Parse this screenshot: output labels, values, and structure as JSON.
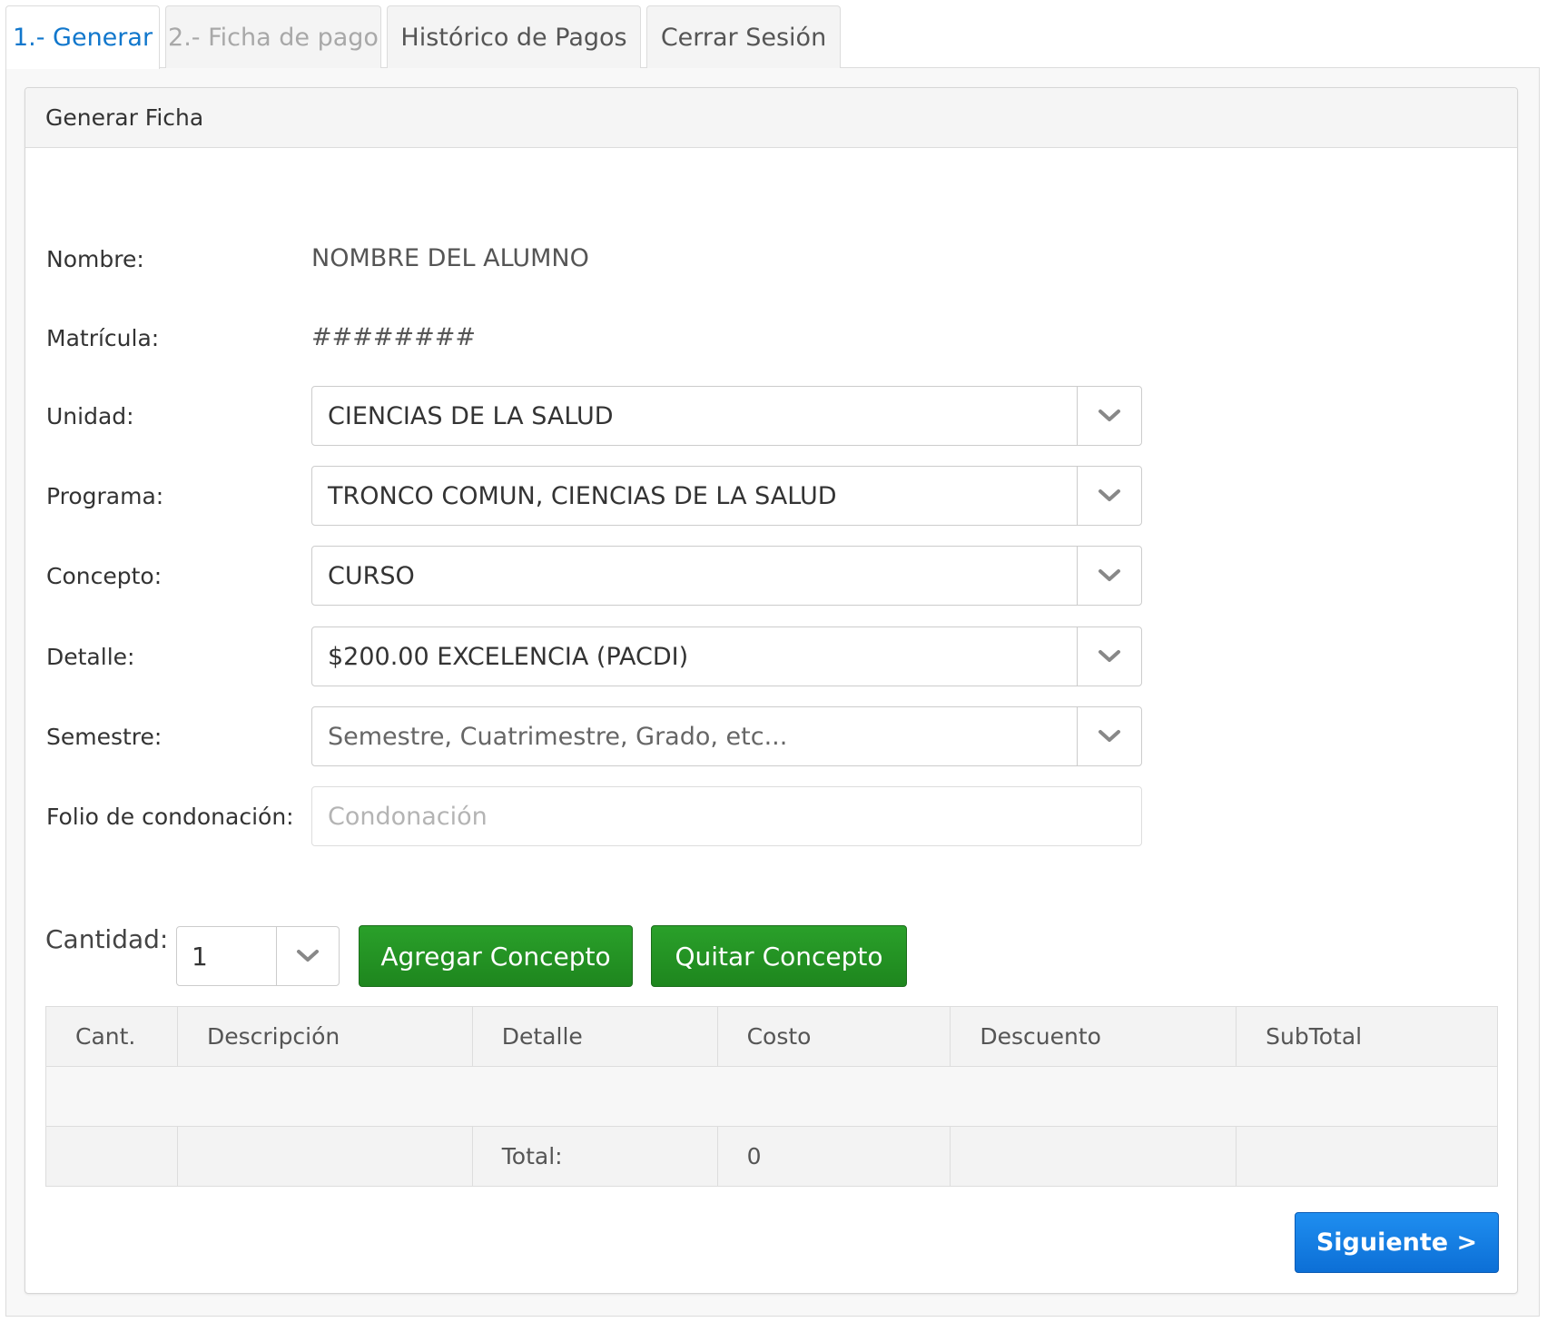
{
  "tabs": [
    {
      "label": "1.- Generar",
      "state": "active"
    },
    {
      "label": "2.- Ficha de pago",
      "state": "disabled"
    },
    {
      "label": "Histórico de Pagos",
      "state": "normal"
    },
    {
      "label": "Cerrar Sesión",
      "state": "normal"
    }
  ],
  "panel": {
    "title": "Generar Ficha"
  },
  "form": {
    "nombre": {
      "label": "Nombre:",
      "value": "NOMBRE DEL ALUMNO"
    },
    "matricula": {
      "label": "Matrícula:",
      "value": "########"
    },
    "unidad": {
      "label": "Unidad:",
      "selected": "CIENCIAS DE LA SALUD"
    },
    "programa": {
      "label": "Programa:",
      "selected": "TRONCO COMUN, CIENCIAS DE LA SALUD"
    },
    "concepto": {
      "label": "Concepto:",
      "selected": "CURSO"
    },
    "detalle": {
      "label": "Detalle:",
      "selected": "$200.00 EXCELENCIA (PACDI)"
    },
    "semestre": {
      "label": "Semestre:",
      "placeholder": "Semestre, Cuatrimestre, Grado, etc..."
    },
    "folio": {
      "label": "Folio de condonación:",
      "placeholder": "Condonación",
      "value": ""
    }
  },
  "cantidad": {
    "label": "Cantidad:",
    "selected": "1"
  },
  "buttons": {
    "agregar": "Agregar Concepto",
    "quitar": "Quitar Concepto",
    "siguiente": "Siguiente >"
  },
  "table": {
    "headers": [
      "Cant.",
      "Descripción",
      "Detalle",
      "Costo",
      "Descuento",
      "SubTotal"
    ],
    "total_label": "Total:",
    "total_value": "0"
  },
  "icons": {
    "select_arrow": "chevron-down-icon"
  },
  "colors": {
    "tab_active_text": "#1177cc",
    "green_button": "#1e861e",
    "blue_button": "#0c6fd6"
  }
}
